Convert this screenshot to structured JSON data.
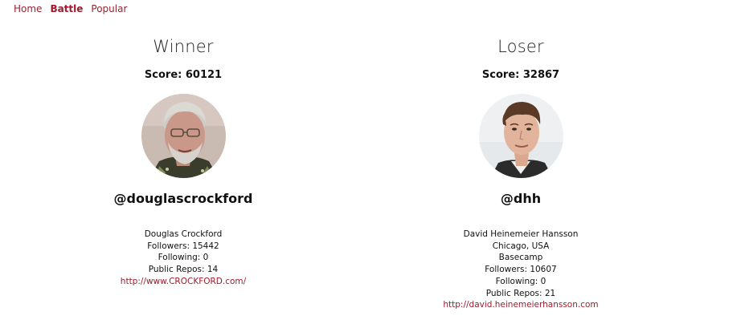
{
  "nav": {
    "home": "Home",
    "battle": "Battle",
    "popular": "Popular"
  },
  "winner": {
    "header": "Winner",
    "score": "Score: 60121",
    "username": "@douglascrockford",
    "name": "Douglas Crockford",
    "followers": "Followers: 15442",
    "following": "Following: 0",
    "repos": "Public Repos: 14",
    "blog": "http://www.CROCKFORD.com/"
  },
  "loser": {
    "header": "Loser",
    "score": "Score: 32867",
    "username": "@dhh",
    "name": "David Heinemeier Hansson",
    "location": "Chicago, USA",
    "company": "Basecamp",
    "followers": "Followers: 10607",
    "following": "Following: 0",
    "repos": "Public Repos: 21",
    "blog": "http://david.heinemeierhansson.com"
  },
  "colors": {
    "accent": "#a1192b",
    "nav_link": "#9a2230"
  }
}
